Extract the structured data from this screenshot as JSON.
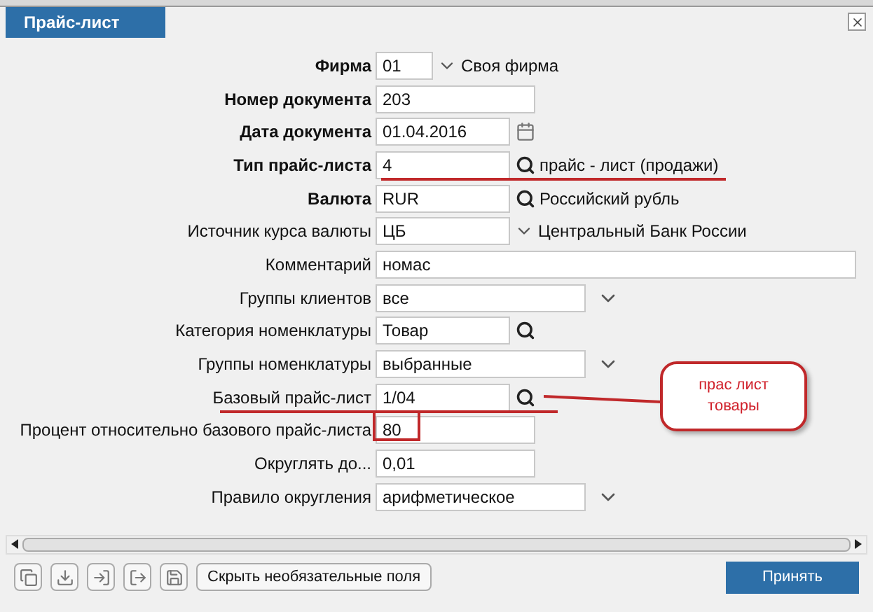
{
  "window": {
    "tab": "Прайс-лист"
  },
  "fields": [
    {
      "label": "Фирма",
      "bold": true,
      "kind": "short-combo",
      "value": "01",
      "note": "Своя фирма"
    },
    {
      "label": "Номер документа",
      "bold": true,
      "kind": "text",
      "value": "203"
    },
    {
      "label": "Дата документа",
      "bold": true,
      "kind": "date",
      "value": "01.04.2016"
    },
    {
      "label": "Тип прайс-листа",
      "bold": true,
      "kind": "lookup",
      "value": "4",
      "note": "прайс - лист (продажи)",
      "underlined": true
    },
    {
      "label": "Валюта",
      "bold": true,
      "kind": "lookup",
      "value": "RUR",
      "note": "Российский рубль"
    },
    {
      "label": "Источник курса валюты",
      "bold": false,
      "kind": "combo",
      "value": "ЦБ",
      "note": "Центральный Банк России"
    },
    {
      "label": "Комментарий",
      "bold": false,
      "kind": "memo",
      "value": "номас"
    },
    {
      "label": "Группы клиентов",
      "bold": false,
      "kind": "select",
      "value": "все"
    },
    {
      "label": "Категория номенклатуры",
      "bold": false,
      "kind": "lookup",
      "value": "Товар"
    },
    {
      "label": "Группы номенклатуры",
      "bold": false,
      "kind": "select",
      "value": "выбранные"
    },
    {
      "label": "Базовый прайс-лист",
      "bold": false,
      "kind": "lookup",
      "value": "1/04",
      "underlined": true
    },
    {
      "label": "Процент относительно базового прайс-листа",
      "bold": false,
      "kind": "text",
      "value": "80",
      "boxed": true
    },
    {
      "label": "Округлять до...",
      "bold": false,
      "kind": "text",
      "value": "0,01"
    },
    {
      "label": "Правило округления",
      "bold": false,
      "kind": "select",
      "value": "арифметическое"
    }
  ],
  "callout": {
    "text": "прас лист товары"
  },
  "footer": {
    "toggle_button": "Скрыть необязательные поля",
    "accept_button": "Принять"
  }
}
